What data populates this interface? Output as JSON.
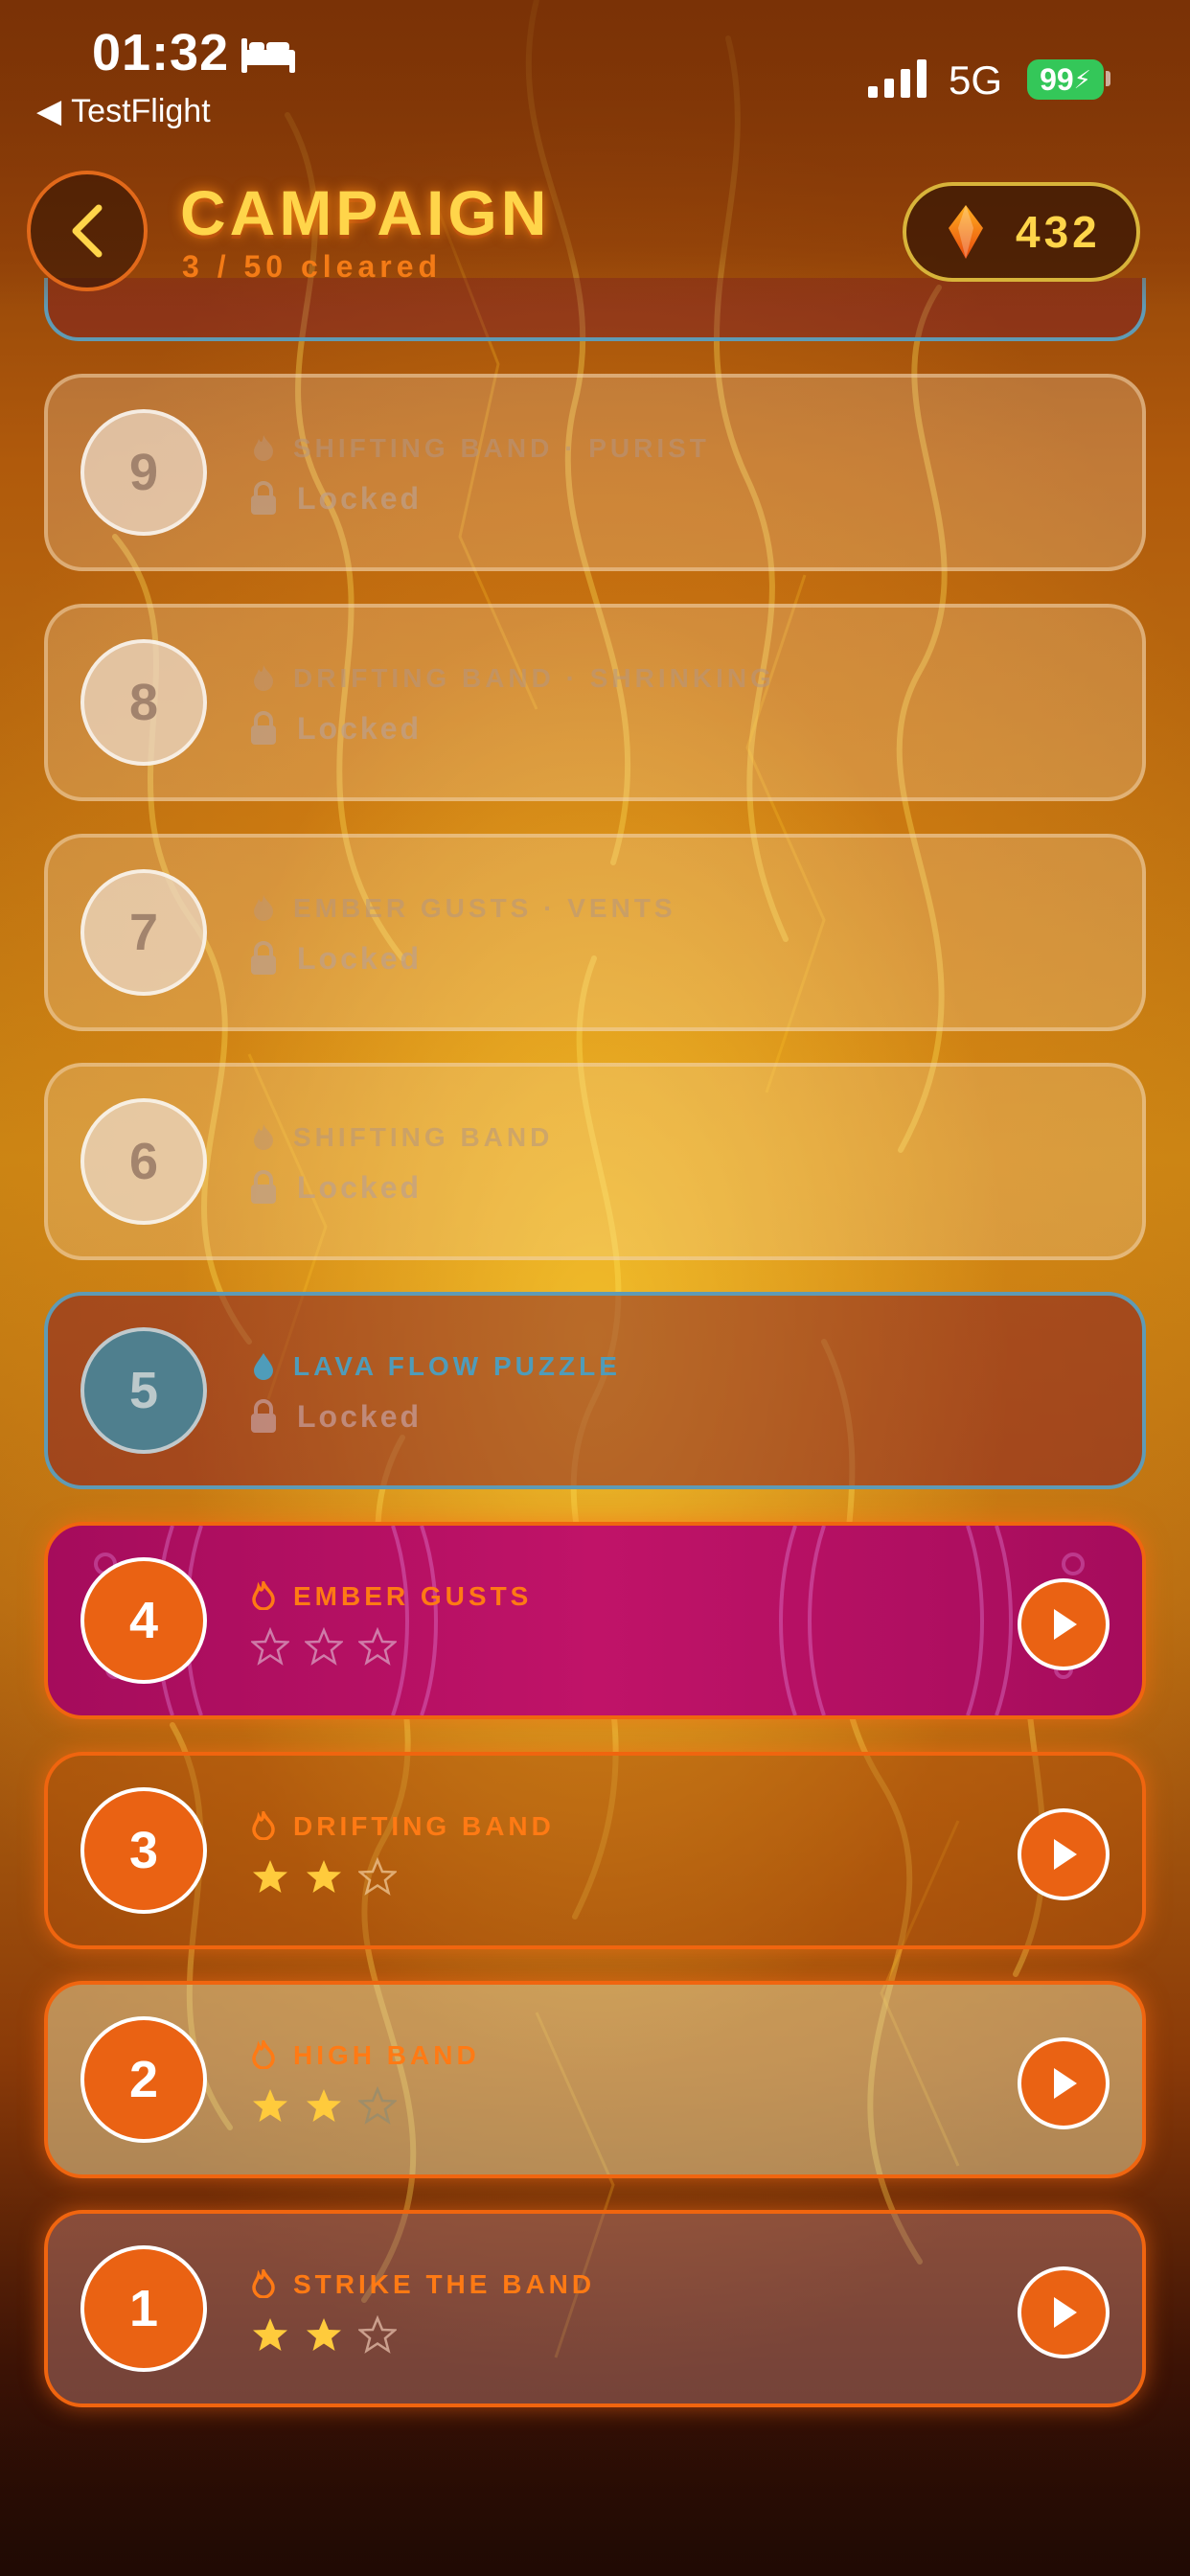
{
  "status_bar": {
    "time": "01:32",
    "back_app": "TestFlight",
    "network": "5G",
    "battery": "99"
  },
  "header": {
    "title": "CAMPAIGN",
    "subtitle": "3 / 50 cleared",
    "gem_count": "432"
  },
  "colors": {
    "accent_orange": "#ea6213",
    "title_gold": "#ffd54a",
    "star_gold": "#ffcb3c",
    "water_blue": "#4f9cba"
  },
  "levels": [
    {
      "number": "9",
      "name": "SHIFTING BAND · PURIST",
      "status": "Locked",
      "icon": "flame-icon"
    },
    {
      "number": "8",
      "name": "DRIFTING BAND · SHRINKING",
      "status": "Locked",
      "icon": "flame-icon"
    },
    {
      "number": "7",
      "name": "EMBER GUSTS · VENTS",
      "status": "Locked",
      "icon": "flame-icon"
    },
    {
      "number": "6",
      "name": "SHIFTING BAND",
      "status": "Locked",
      "icon": "flame-icon"
    },
    {
      "number": "5",
      "name": "LAVA FLOW PUZZLE",
      "status": "Locked",
      "icon": "water-drop-icon"
    },
    {
      "number": "4",
      "name": "EMBER GUSTS",
      "stars": 0,
      "max_stars": 3,
      "icon": "flame-icon"
    },
    {
      "number": "3",
      "name": "DRIFTING BAND",
      "stars": 2,
      "max_stars": 3,
      "icon": "flame-icon"
    },
    {
      "number": "2",
      "name": "HIGH BAND",
      "stars": 2,
      "max_stars": 3,
      "icon": "flame-icon"
    },
    {
      "number": "1",
      "name": "STRIKE THE BAND",
      "stars": 2,
      "max_stars": 3,
      "icon": "flame-icon"
    }
  ]
}
